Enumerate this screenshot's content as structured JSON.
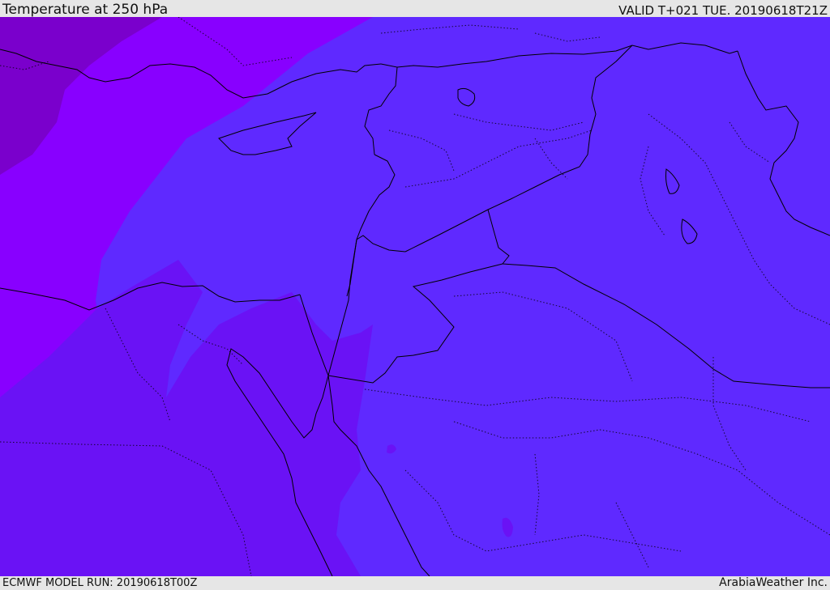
{
  "header": {
    "title": "Temperature at 250 hPa",
    "valid": "VALID T+021 TUE. 20190618T21Z"
  },
  "footer": {
    "model_run": "ECMWF MODEL RUN: 20190618T00Z",
    "credit": "ArabiaWeather Inc."
  },
  "map": {
    "field": "temperature",
    "level": "250 hPa",
    "colors": {
      "coldest": "#7a00cc",
      "cold": "#8800ff",
      "mid": "#6a12f5",
      "warm": "#5f29ff",
      "border": "#000000"
    }
  }
}
